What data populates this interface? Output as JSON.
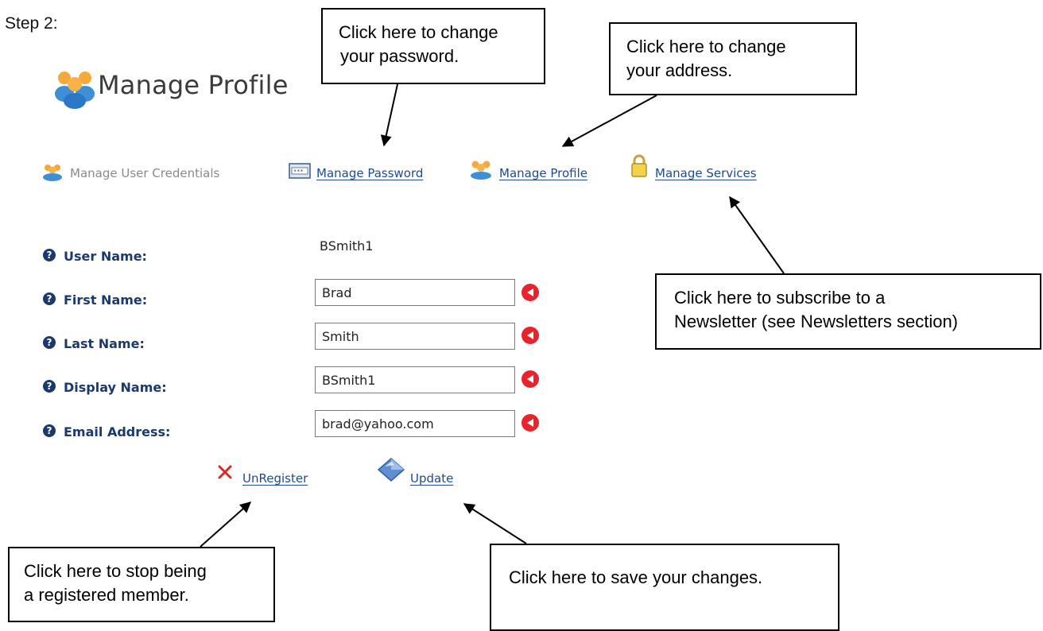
{
  "step_label": "Step 2:",
  "page_title": "Manage Profile",
  "nav": {
    "credentials": "Manage User Credentials",
    "password": "Manage Password",
    "profile": "Manage Profile",
    "services": "Manage Services"
  },
  "form": {
    "user_name_label": "User Name:",
    "user_name_value": "BSmith1",
    "first_name_label": "First Name:",
    "first_name_value": "Brad",
    "last_name_label": "Last Name:",
    "last_name_value": "Smith",
    "display_name_label": "Display Name:",
    "display_name_value": "BSmith1",
    "email_label": "Email Address:",
    "email_value": "brad@yahoo.com"
  },
  "actions": {
    "unregister": "UnRegister",
    "update": "Update"
  },
  "callouts": {
    "password_line1": "Click here to change",
    "password_line2": "your password.",
    "address_line1": "Click here to change",
    "address_line2": "your address.",
    "newsletter_line1": "Click here to subscribe to a",
    "newsletter_line2": "Newsletter (see Newsletters section)",
    "unregister_line1": "Click here to stop being",
    "unregister_line2": "a registered member.",
    "update_line1": "Click here to save your changes."
  },
  "icons": {
    "title": "users-icon",
    "credentials": "users-icon",
    "password": "keypad-icon",
    "profile": "users-icon",
    "services": "padlock-icon",
    "help": "question-circle-icon",
    "required": "red-arrow-left-icon",
    "unregister": "x-icon",
    "update": "diamond-icon"
  },
  "colors": {
    "link": "#1f4b8a",
    "label": "#1b3a6b",
    "required": "#e8232b",
    "unregister_x": "#d42a2a"
  }
}
